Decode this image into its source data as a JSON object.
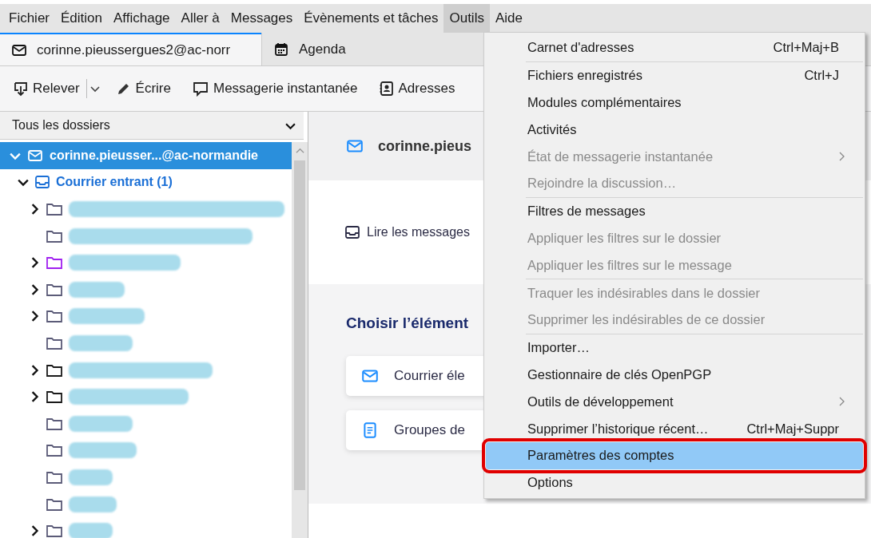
{
  "menubar": [
    {
      "label": "Fichier",
      "selected": false
    },
    {
      "label": "Édition",
      "selected": false
    },
    {
      "label": "Affichage",
      "selected": false
    },
    {
      "label": "Aller à",
      "selected": false
    },
    {
      "label": "Messages",
      "selected": false
    },
    {
      "label": "Évènements et tâches",
      "selected": false
    },
    {
      "label": "Outils",
      "selected": true
    },
    {
      "label": "Aide",
      "selected": false
    }
  ],
  "tabs": [
    {
      "label": "corinne.pieussergues2@ac-norr",
      "kind": "mail",
      "selected": true
    },
    {
      "label": "Agenda",
      "kind": "calendar",
      "selected": false
    }
  ],
  "toolbar": [
    {
      "label": "Relever",
      "kind": "get"
    },
    {
      "label": "Écrire",
      "kind": "write"
    },
    {
      "label": "Messagerie instantanée",
      "kind": "chat"
    },
    {
      "label": "Adresses",
      "kind": "contacts"
    }
  ],
  "sidebar": {
    "selector": "Tous les dossiers",
    "tree": [
      {
        "label": "corinne.pieusser...@ac-normandie",
        "kind": "account",
        "selected": true,
        "expanded": true,
        "children": [
          {
            "label": "Courrier entrant (1)",
            "kind": "inbox",
            "selected": false,
            "expanded": true,
            "children": [
              {
                "kind": "folder",
                "expandable": true,
                "color": "#5b5b78"
              },
              {
                "kind": "folder",
                "expandable": false,
                "color": "#5b5b78"
              },
              {
                "kind": "folder",
                "expandable": true,
                "color": "#a020f0"
              },
              {
                "kind": "folder",
                "expandable": true,
                "color": "#5b5b78"
              },
              {
                "kind": "folder",
                "expandable": true,
                "color": "#5b5b78"
              },
              {
                "kind": "folder",
                "expandable": false,
                "color": "#5b5b78"
              },
              {
                "kind": "folder",
                "expandable": true,
                "color": "#1a1a1a"
              },
              {
                "kind": "folder",
                "expandable": true,
                "color": "#1a1a1a"
              },
              {
                "kind": "folder",
                "expandable": false,
                "color": "#5b5b78"
              },
              {
                "kind": "folder",
                "expandable": false,
                "color": "#5b5b78"
              },
              {
                "kind": "folder",
                "expandable": false,
                "color": "#5b5b78"
              },
              {
                "kind": "folder",
                "expandable": false,
                "color": "#5b5b78"
              },
              {
                "kind": "folder",
                "expandable": true,
                "color": "#5b5b78"
              }
            ]
          }
        ]
      }
    ]
  },
  "main": {
    "account": "corinne.pieus",
    "read_messages": "Lire les messages",
    "section_title": "Choisir l’élément",
    "cards": [
      {
        "label": "Courrier éle",
        "kind": "mail"
      },
      {
        "label": "Groupes de",
        "kind": "news"
      }
    ]
  },
  "menu": [
    {
      "kind": "item",
      "label": "Carnet d'adresses",
      "shortcut": "Ctrl+Maj+B",
      "disabled": false,
      "submenu": false,
      "selected": false,
      "annotated": false
    },
    {
      "kind": "separator"
    },
    {
      "kind": "item",
      "label": "Fichiers enregistrés",
      "shortcut": "Ctrl+J",
      "disabled": false,
      "submenu": false,
      "selected": false,
      "annotated": false
    },
    {
      "kind": "item",
      "label": "Modules complémentaires",
      "disabled": false,
      "submenu": false,
      "selected": false,
      "annotated": false
    },
    {
      "kind": "item",
      "label": "Activités",
      "disabled": false,
      "submenu": false,
      "selected": false,
      "annotated": false
    },
    {
      "kind": "item",
      "label": "État de messagerie instantanée",
      "disabled": true,
      "submenu": true,
      "selected": false,
      "annotated": false
    },
    {
      "kind": "item",
      "label": "Rejoindre la discussion…",
      "disabled": true,
      "submenu": false,
      "selected": false,
      "annotated": false
    },
    {
      "kind": "separator"
    },
    {
      "kind": "item",
      "label": "Filtres de messages",
      "disabled": false,
      "submenu": false,
      "selected": false,
      "annotated": false
    },
    {
      "kind": "item",
      "label": "Appliquer les filtres sur le dossier",
      "disabled": true,
      "submenu": false,
      "selected": false,
      "annotated": false
    },
    {
      "kind": "item",
      "label": "Appliquer les filtres sur le message",
      "disabled": true,
      "submenu": false,
      "selected": false,
      "annotated": false
    },
    {
      "kind": "separator"
    },
    {
      "kind": "item",
      "label": "Traquer les indésirables dans le dossier",
      "disabled": true,
      "submenu": false,
      "selected": false,
      "annotated": false
    },
    {
      "kind": "item",
      "label": "Supprimer les indésirables de ce dossier",
      "disabled": true,
      "submenu": false,
      "selected": false,
      "annotated": false
    },
    {
      "kind": "separator"
    },
    {
      "kind": "item",
      "label": "Importer…",
      "disabled": false,
      "submenu": false,
      "selected": false,
      "annotated": false
    },
    {
      "kind": "item",
      "label": "Gestionnaire de clés OpenPGP",
      "disabled": false,
      "submenu": false,
      "selected": false,
      "annotated": false
    },
    {
      "kind": "item",
      "label": "Outils de développement",
      "disabled": false,
      "submenu": true,
      "selected": false,
      "annotated": false
    },
    {
      "kind": "item",
      "label": "Supprimer l’historique récent…",
      "shortcut": "Ctrl+Maj+Suppr",
      "disabled": false,
      "submenu": false,
      "selected": false,
      "annotated": false
    },
    {
      "kind": "item",
      "label": "Paramètres des comptes",
      "disabled": false,
      "submenu": false,
      "selected": true,
      "annotated": true
    },
    {
      "kind": "item",
      "label": "Options",
      "disabled": false,
      "submenu": false,
      "selected": false,
      "annotated": false
    }
  ]
}
